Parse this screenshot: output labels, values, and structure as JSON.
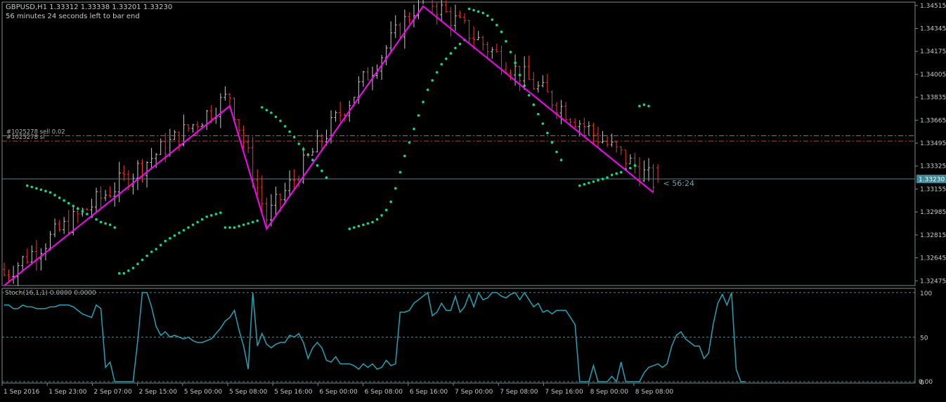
{
  "header": {
    "symbol_line": "GBPUSD,H1  1.33312 1.33338 1.33201 1.33230",
    "timer_line": "56 minutes 24 seconds left to bar end"
  },
  "orders": {
    "sell_label": "#1025278 sell 0.02",
    "sl_label": "#1025278 sl"
  },
  "countdown": "< 56:24",
  "price_axis": {
    "ticks": [
      "1.34515",
      "1.34345",
      "1.34175",
      "1.34005",
      "1.33835",
      "1.33665",
      "1.33495",
      "1.33325",
      "1.33155",
      "1.32985",
      "1.32815",
      "1.32645",
      "1.32475"
    ],
    "current_price": "1.33230"
  },
  "indicator": {
    "label": "Stoch(16,1,1) 0.0000 0.0000",
    "levels": [
      "100",
      "50",
      "0"
    ],
    "level_extra": "0.00"
  },
  "time_axis": [
    "1 Sep 2016",
    "1 Sep 23:00",
    "2 Sep 07:00",
    "2 Sep 15:00",
    "5 Sep 00:00",
    "5 Sep 08:00",
    "5 Sep 16:00",
    "6 Sep 00:00",
    "6 Sep 08:00",
    "6 Sep 16:00",
    "7 Sep 00:00",
    "7 Sep 08:00",
    "7 Sep 16:00",
    "8 Sep 00:00",
    "8 Sep 08:00"
  ],
  "colors": {
    "background": "#000000",
    "frame": "#7f8a8a",
    "bull": "#c8c8c8",
    "bear": "#ff3030",
    "zigzag": "#ff00ff",
    "sar": "#00e28a",
    "stoch": "#1fa5b5",
    "sell_line": "#26a269",
    "sl_line": "#e03030"
  },
  "chart_data": {
    "type": "candlestick",
    "symbol": "GBPUSD",
    "timeframe": "H1",
    "last_bar": {
      "open": 1.33312,
      "high": 1.33338,
      "low": 1.33201,
      "close": 1.3323
    },
    "ylim": [
      1.3244,
      1.3454
    ],
    "price_levels": {
      "sell_order": 1.3355,
      "stop_loss": 1.3351,
      "current": 1.3323
    },
    "zigzag": [
      {
        "bar": 0,
        "price": 1.3244
      },
      {
        "bar": 49,
        "price": 1.3377
      },
      {
        "bar": 57,
        "price": 1.3286
      },
      {
        "bar": 91,
        "price": 1.3451
      },
      {
        "bar": 141,
        "price": 1.3313
      }
    ],
    "sar": [
      [
        5,
        1.3318
      ],
      [
        6,
        1.3317
      ],
      [
        7,
        1.3316
      ],
      [
        8,
        1.3315
      ],
      [
        9,
        1.3314
      ],
      [
        10,
        1.3313
      ],
      [
        11,
        1.3311
      ],
      [
        12,
        1.3309
      ],
      [
        13,
        1.3307
      ],
      [
        14,
        1.3305
      ],
      [
        15,
        1.3303
      ],
      [
        16,
        1.3301
      ],
      [
        17,
        1.3299
      ],
      [
        18,
        1.3297
      ],
      [
        19,
        1.3295
      ],
      [
        20,
        1.3293
      ],
      [
        21,
        1.3291
      ],
      [
        22,
        1.329
      ],
      [
        23,
        1.3289
      ],
      [
        24,
        1.3287
      ],
      [
        25,
        1.3253
      ],
      [
        26,
        1.3253
      ],
      [
        27,
        1.3255
      ],
      [
        28,
        1.3257
      ],
      [
        29,
        1.326
      ],
      [
        30,
        1.3263
      ],
      [
        31,
        1.3266
      ],
      [
        32,
        1.3269
      ],
      [
        33,
        1.3271
      ],
      [
        34,
        1.3274
      ],
      [
        35,
        1.3277
      ],
      [
        36,
        1.3279
      ],
      [
        37,
        1.3281
      ],
      [
        38,
        1.3283
      ],
      [
        39,
        1.3285
      ],
      [
        40,
        1.3287
      ],
      [
        41,
        1.3289
      ],
      [
        42,
        1.3291
      ],
      [
        43,
        1.3293
      ],
      [
        44,
        1.3295
      ],
      [
        45,
        1.3296
      ],
      [
        46,
        1.3297
      ],
      [
        47,
        1.3298
      ],
      [
        48,
        1.3287
      ],
      [
        49,
        1.3287
      ],
      [
        50,
        1.3287
      ],
      [
        51,
        1.3288
      ],
      [
        52,
        1.3289
      ],
      [
        53,
        1.329
      ],
      [
        54,
        1.3291
      ],
      [
        55,
        1.3292
      ],
      [
        56,
        1.3376
      ],
      [
        57,
        1.3374
      ],
      [
        58,
        1.3372
      ],
      [
        59,
        1.3369
      ],
      [
        60,
        1.3366
      ],
      [
        61,
        1.3362
      ],
      [
        62,
        1.3358
      ],
      [
        63,
        1.3354
      ],
      [
        64,
        1.3349
      ],
      [
        65,
        1.3345
      ],
      [
        66,
        1.3341
      ],
      [
        67,
        1.3337
      ],
      [
        68,
        1.3333
      ],
      [
        69,
        1.3329
      ],
      [
        70,
        1.3324
      ],
      [
        75,
        1.3286
      ],
      [
        76,
        1.3287
      ],
      [
        77,
        1.3288
      ],
      [
        78,
        1.3289
      ],
      [
        79,
        1.329
      ],
      [
        80,
        1.3291
      ],
      [
        81,
        1.3293
      ],
      [
        82,
        1.3296
      ],
      [
        83,
        1.33
      ],
      [
        84,
        1.3306
      ],
      [
        85,
        1.3316
      ],
      [
        86,
        1.3328
      ],
      [
        87,
        1.334
      ],
      [
        88,
        1.335
      ],
      [
        89,
        1.336
      ],
      [
        90,
        1.337
      ],
      [
        91,
        1.338
      ],
      [
        92,
        1.3389
      ],
      [
        93,
        1.3396
      ],
      [
        94,
        1.3402
      ],
      [
        95,
        1.3408
      ],
      [
        96,
        1.3412
      ],
      [
        97,
        1.3416
      ],
      [
        98,
        1.342
      ],
      [
        99,
        1.3423
      ],
      [
        100,
        1.3426
      ],
      [
        101,
        1.3449
      ],
      [
        102,
        1.3448
      ],
      [
        103,
        1.3447
      ],
      [
        104,
        1.3446
      ],
      [
        105,
        1.3444
      ],
      [
        106,
        1.3441
      ],
      [
        107,
        1.3437
      ],
      [
        108,
        1.3432
      ],
      [
        109,
        1.3425
      ],
      [
        110,
        1.3417
      ],
      [
        111,
        1.3409
      ],
      [
        112,
        1.34
      ],
      [
        113,
        1.3392
      ],
      [
        114,
        1.3385
      ],
      [
        115,
        1.3378
      ],
      [
        116,
        1.3371
      ],
      [
        117,
        1.3364
      ],
      [
        118,
        1.3357
      ],
      [
        119,
        1.335
      ],
      [
        120,
        1.3343
      ],
      [
        121,
        1.3337
      ],
      [
        125,
        1.3318
      ],
      [
        126,
        1.3319
      ],
      [
        127,
        1.332
      ],
      [
        128,
        1.3321
      ],
      [
        129,
        1.3322
      ],
      [
        130,
        1.3323
      ],
      [
        131,
        1.3324
      ],
      [
        132,
        1.3326
      ],
      [
        133,
        1.3327
      ],
      [
        134,
        1.3328
      ],
      [
        135,
        1.333
      ],
      [
        136,
        1.3331
      ],
      [
        137,
        1.3333
      ],
      [
        138,
        1.3377
      ],
      [
        139,
        1.3378
      ],
      [
        140,
        1.3377
      ]
    ],
    "stochastic": {
      "name": "Stoch(16,1,1)",
      "ylim": [
        0,
        100
      ],
      "levels": [
        100,
        50,
        0
      ],
      "values": [
        86,
        86,
        82,
        82,
        86,
        84,
        84,
        82,
        82,
        82,
        84,
        84,
        86,
        86,
        86,
        84,
        80,
        76,
        74,
        72,
        86,
        82,
        16,
        22,
        0,
        0,
        0,
        0,
        0,
        46,
        100,
        100,
        84,
        62,
        52,
        56,
        50,
        52,
        50,
        48,
        50,
        46,
        44,
        44,
        46,
        48,
        54,
        60,
        68,
        72,
        80,
        58,
        40,
        14,
        100,
        40,
        54,
        42,
        38,
        42,
        44,
        44,
        52,
        50,
        54,
        44,
        26,
        38,
        44,
        38,
        24,
        22,
        28,
        20,
        20,
        20,
        18,
        14,
        20,
        16,
        20,
        14,
        16,
        24,
        18,
        20,
        78,
        78,
        80,
        88,
        92,
        96,
        100,
        74,
        78,
        88,
        80,
        80,
        96,
        78,
        84,
        98,
        84,
        100,
        92,
        94,
        100,
        100,
        96,
        94,
        98,
        100,
        92,
        100,
        92,
        84,
        88,
        78,
        80,
        76,
        80,
        80,
        80,
        72,
        64,
        0,
        0,
        0,
        18,
        0,
        0,
        0,
        6,
        0,
        22,
        0,
        0,
        0,
        0,
        10,
        16,
        18,
        20,
        16,
        20,
        40,
        52,
        56,
        48,
        44,
        40,
        40,
        26,
        32,
        64,
        88,
        98,
        86,
        100,
        14,
        0,
        0
      ]
    },
    "candles": []
  }
}
